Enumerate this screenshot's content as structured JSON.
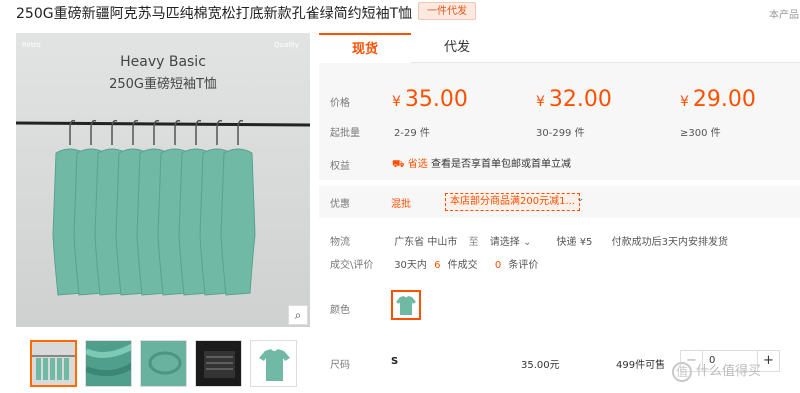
{
  "header": {
    "title": "250G重磅新疆阿克苏马匹纯棉宽松打底新款孔雀绿简约短袖T恤",
    "tag": "一件代发",
    "right_note": "本产品"
  },
  "gallery": {
    "corner_left": "Retro",
    "corner_right": "Quality",
    "line1": "Heavy Basic",
    "line2": "250G重磅短袖T恤",
    "zoom_icon": "magnifier-icon"
  },
  "tabs": [
    {
      "label": "现货",
      "active": true
    },
    {
      "label": "代发",
      "active": false
    }
  ],
  "pricing": {
    "price_label": "价格",
    "moq_label": "起批量",
    "tiers": [
      {
        "currency": "¥",
        "price": "35.00",
        "qty": "2-29 件"
      },
      {
        "currency": "¥",
        "price": "32.00",
        "qty": "30-299 件"
      },
      {
        "currency": "¥",
        "price": "29.00",
        "qty": "≥300 件"
      }
    ],
    "benefit_label": "权益",
    "benefit_tag": "省选",
    "benefit_text": "查看是否享首单包邮或首单立减"
  },
  "promo": {
    "label": "优惠",
    "type": "混批",
    "badge": "本店部分商品满200元减1..."
  },
  "logistics": {
    "label": "物流",
    "origin": "广东省 中山市",
    "to": "至",
    "select": "请选择",
    "express": "快递 ¥5",
    "note": "付款成功后3天内安排发货"
  },
  "reviews": {
    "label": "成交\\评价",
    "deals_pre": "30天内",
    "deals_num": "6",
    "deals_post": "件成交",
    "reviews_num": "0",
    "reviews_post": "条评价"
  },
  "color": {
    "label": "颜色"
  },
  "size": {
    "label": "尺码",
    "value": "S",
    "price": "35.00元",
    "stock": "499件可售",
    "quantity": "0",
    "minus": "−",
    "plus": "+"
  },
  "watermark": {
    "icon": "值",
    "text": "什么值得买"
  },
  "colors": {
    "accent": "#ff5000",
    "shirt": "#6fb9a5"
  }
}
